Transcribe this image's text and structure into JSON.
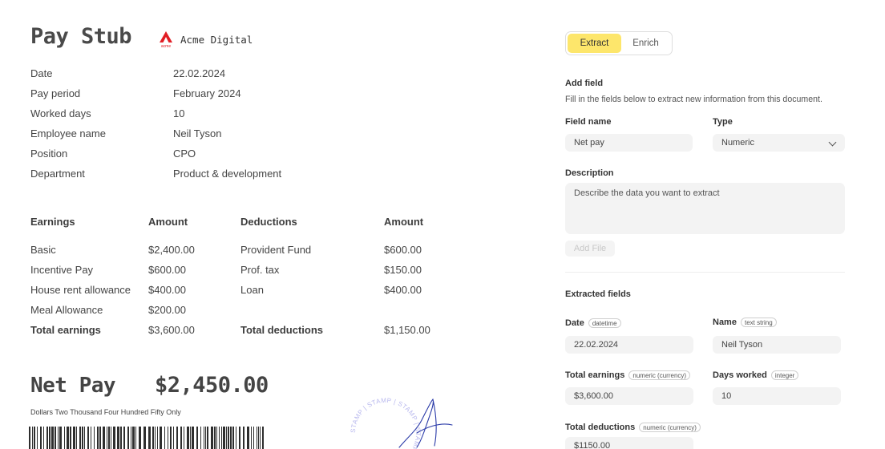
{
  "document": {
    "title": "Pay Stub",
    "company": "Acme Digital",
    "logo_caption": "acme",
    "brand_color": "#e11d24",
    "info": [
      {
        "label": "Date",
        "value": "22.02.2024"
      },
      {
        "label": "Pay period",
        "value": "February 2024"
      },
      {
        "label": "Worked days",
        "value": "10"
      },
      {
        "label": "Employee name",
        "value": "Neil Tyson"
      },
      {
        "label": "Position",
        "value": "CPO"
      },
      {
        "label": "Department",
        "value": "Product & development"
      }
    ],
    "table": {
      "headers": [
        "Earnings",
        "Amount",
        "Deductions",
        "Amount"
      ],
      "rows": [
        {
          "earning": "Basic",
          "earning_amount": "$2,400.00",
          "deduction": "Provident Fund",
          "deduction_amount": "$600.00"
        },
        {
          "earning": "Incentive Pay",
          "earning_amount": "$600.00",
          "deduction": "Prof. tax",
          "deduction_amount": "$150.00"
        },
        {
          "earning": "House rent allowance",
          "earning_amount": "$400.00",
          "deduction": "Loan",
          "deduction_amount": "$400.00"
        },
        {
          "earning": "Meal Allowance",
          "earning_amount": "$200.00",
          "deduction": "",
          "deduction_amount": ""
        }
      ],
      "totals": {
        "earning": "Total earnings",
        "earning_amount": "$3,600.00",
        "deduction": "Total deductions",
        "deduction_amount": "$1,150.00"
      }
    },
    "net_pay_label": "Net Pay",
    "net_pay_value": "$2,450.00",
    "net_pay_words": "Dollars Two Thousand Four Hundred Fifty Only",
    "stamp_text": "STAMP | STAMP | STAMP | STAMP |",
    "stamp_color": "#b8b8ee",
    "signature_color": "#2a3aa8"
  },
  "panel": {
    "tabs": [
      {
        "label": "Extract",
        "active": true
      },
      {
        "label": "Enrich",
        "active": false
      }
    ],
    "accent_color": "#fde66b",
    "add_field": {
      "title": "Add field",
      "hint": "Fill in the fields below to extract new information from this document.",
      "field_name_label": "Field name",
      "field_name_value": "Net pay",
      "type_label": "Type",
      "type_value": "Numeric",
      "description_label": "Description",
      "description_placeholder": "Describe the data you want to extract",
      "add_button": "Add File"
    },
    "extracted": {
      "title": "Extracted fields",
      "fields": [
        {
          "label": "Date",
          "type": "datetime",
          "value": "22.02.2024"
        },
        {
          "label": "Name",
          "type": "text string",
          "value": "Neil Tyson"
        },
        {
          "label": "Total earnings",
          "type": "numeric (currency)",
          "value": "$3,600.00"
        },
        {
          "label": "Days worked",
          "type": "integer",
          "value": "10"
        },
        {
          "label": "Total deductions",
          "type": "numeric (currency)",
          "value": "$1150.00"
        }
      ]
    }
  }
}
